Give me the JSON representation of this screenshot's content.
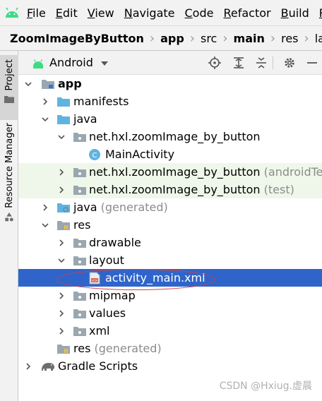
{
  "menubar": {
    "items": [
      {
        "label": "File",
        "u": "F",
        "rest": "ile"
      },
      {
        "label": "Edit",
        "u": "E",
        "rest": "dit"
      },
      {
        "label": "View",
        "u": "V",
        "rest": "iew"
      },
      {
        "label": "Navigate",
        "u": "N",
        "rest": "avigate"
      },
      {
        "label": "Code",
        "u": "C",
        "rest": "ode"
      },
      {
        "label": "Refactor",
        "u": "R",
        "rest": "efactor"
      },
      {
        "label": "Build",
        "u": "B",
        "rest": "uild"
      },
      {
        "label": "R",
        "u": "R",
        "rest": ""
      }
    ]
  },
  "breadcrumb": [
    "ZoomImageByButton",
    "app",
    "src",
    "main",
    "res",
    "layout"
  ],
  "sidebar": {
    "project_label": "Project",
    "resource_label": "Resource Manager"
  },
  "toolbar": {
    "view_label": "Android"
  },
  "tree": [
    {
      "label": "app",
      "suffix": ""
    },
    {
      "label": "manifests",
      "suffix": ""
    },
    {
      "label": "java",
      "suffix": ""
    },
    {
      "label": "net.hxl.zoomImage_by_button",
      "suffix": ""
    },
    {
      "label": "MainActivity",
      "suffix": ""
    },
    {
      "label": "net.hxl.zoomImage_by_button",
      "suffix": "(androidTest)"
    },
    {
      "label": "net.hxl.zoomImage_by_button",
      "suffix": "(test)"
    },
    {
      "label": "java",
      "suffix": "(generated)"
    },
    {
      "label": "res",
      "suffix": ""
    },
    {
      "label": "drawable",
      "suffix": ""
    },
    {
      "label": "layout",
      "suffix": ""
    },
    {
      "label": "activity_main.xml",
      "suffix": ""
    },
    {
      "label": "mipmap",
      "suffix": ""
    },
    {
      "label": "values",
      "suffix": ""
    },
    {
      "label": "xml",
      "suffix": ""
    },
    {
      "label": "res",
      "suffix": "(generated)"
    },
    {
      "label": "Gradle Scripts",
      "suffix": ""
    }
  ],
  "watermark": "CSDN @Hxiug.虚晨",
  "colors": {
    "selection": "#2f65ca",
    "test_bg": "#eef7e9",
    "folder": "#9aa7b0",
    "java_folder": "#5fb3e0",
    "android_green": "#3ddc84"
  }
}
